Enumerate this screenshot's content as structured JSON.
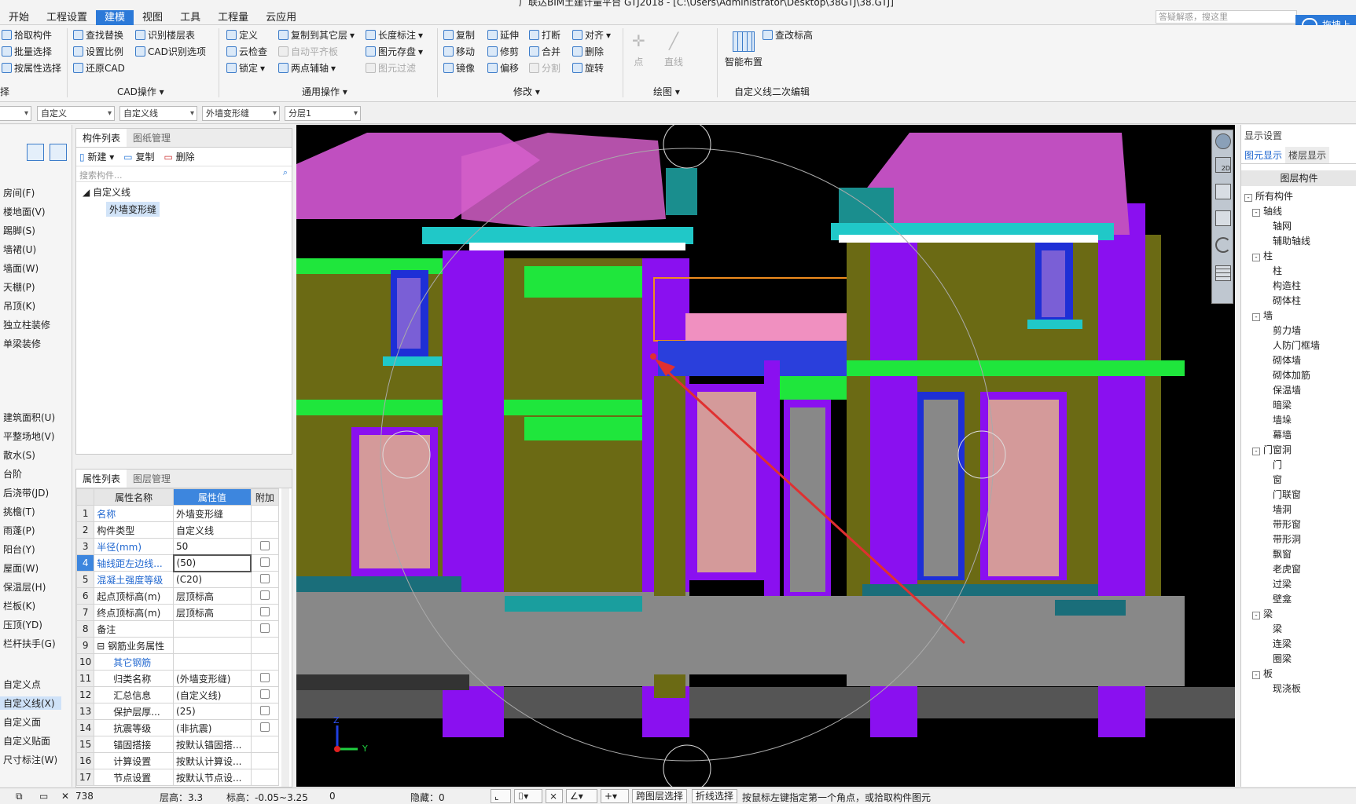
{
  "app": {
    "title": "广联达BIM土建计量平台 GTJ2018 - [C:\\Users\\Administrator\\Desktop\\38GTJ\\38.GTJ]",
    "menu": [
      "开始",
      "工程设置",
      "建模",
      "视图",
      "工具",
      "工程量",
      "云应用"
    ],
    "search_placeholder": "答疑解惑，搜这里",
    "cloud_button": "拖拽上"
  },
  "ribbon": {
    "select": {
      "items": [
        "拾取构件",
        "批量选择",
        "按属性选择"
      ],
      "group": "择"
    },
    "cad": {
      "items": [
        "查找替换",
        "识别楼层表",
        "设置比例",
        "CAD识别选项",
        "还原CAD"
      ],
      "group": "CAD操作"
    },
    "general": {
      "items": [
        "定义",
        "复制到其它层",
        "长度标注",
        "云检查",
        "自动平齐板",
        "图元存盘",
        "锁定",
        "两点辅轴",
        "图元过滤"
      ],
      "group": "通用操作"
    },
    "modify": {
      "items": [
        "复制",
        "延伸",
        "打断",
        "对齐",
        "移动",
        "修剪",
        "合并",
        "删除",
        "镜像",
        "偏移",
        "分割",
        "旋转"
      ],
      "group": "修改"
    },
    "draw": {
      "items": [
        "点",
        "直线"
      ],
      "group": "绘图"
    },
    "custom": {
      "items": [
        "查改标高",
        "智能布置"
      ],
      "group": "自定义线二次编辑"
    }
  },
  "filters": [
    "",
    "自定义",
    "自定义线",
    "外墙变形缝",
    "分层1"
  ],
  "leftnav": {
    "items": [
      "房间(F)",
      "楼地面(V)",
      "踢脚(S)",
      "墙裙(U)",
      "墙面(W)",
      "天棚(P)",
      "吊顶(K)",
      "独立柱装修",
      "单梁装修",
      "建筑面积(U)",
      "平整场地(V)",
      "散水(S)",
      "台阶",
      "后浇带(JD)",
      "挑檐(T)",
      "雨蓬(P)",
      "阳台(Y)",
      "屋面(W)",
      "保温层(H)",
      "栏板(K)",
      "压顶(YD)",
      "栏杆扶手(G)",
      "自定义点",
      "自定义线(X)",
      "自定义面",
      "自定义贴面",
      "尺寸标注(W)"
    ]
  },
  "component_panel": {
    "tabs": [
      "构件列表",
      "图纸管理"
    ],
    "toolbar": {
      "new": "新建",
      "copy": "复制",
      "delete": "删除"
    },
    "search_placeholder": "搜索构件...",
    "tree": {
      "root": "自定义线",
      "child": "外墙变形缝"
    }
  },
  "property_panel": {
    "tabs": [
      "属性列表",
      "图层管理"
    ],
    "headers": [
      "属性名称",
      "属性值",
      "附加"
    ],
    "rows": [
      {
        "n": "1",
        "name": "名称",
        "value": "外墙变形缝",
        "blue": true,
        "cb": false
      },
      {
        "n": "2",
        "name": "构件类型",
        "value": "自定义线",
        "blue": false,
        "cb": false
      },
      {
        "n": "3",
        "name": "半径(mm)",
        "value": "50",
        "blue": true,
        "cb": true
      },
      {
        "n": "4",
        "name": "轴线距左边线...",
        "value": "(50)",
        "blue": true,
        "cb": true
      },
      {
        "n": "5",
        "name": "混凝土强度等级",
        "value": "(C20)",
        "blue": true,
        "cb": true
      },
      {
        "n": "6",
        "name": "起点顶标高(m)",
        "value": "层顶标高",
        "blue": false,
        "cb": true
      },
      {
        "n": "7",
        "name": "终点顶标高(m)",
        "value": "层顶标高",
        "blue": false,
        "cb": true
      },
      {
        "n": "8",
        "name": "备注",
        "value": "",
        "blue": false,
        "cb": true
      },
      {
        "n": "9",
        "name": "钢筋业务属性",
        "value": "",
        "blue": false,
        "cb": false
      },
      {
        "n": "10",
        "name": "其它钢筋",
        "value": "",
        "blue": true,
        "cb": false
      },
      {
        "n": "11",
        "name": "归类名称",
        "value": "(外墙变形缝)",
        "blue": false,
        "cb": true
      },
      {
        "n": "12",
        "name": "汇总信息",
        "value": "(自定义线)",
        "blue": false,
        "cb": true
      },
      {
        "n": "13",
        "name": "保护层厚...",
        "value": "(25)",
        "blue": false,
        "cb": true
      },
      {
        "n": "14",
        "name": "抗震等级",
        "value": "(非抗震)",
        "blue": false,
        "cb": true
      },
      {
        "n": "15",
        "name": "锚固搭接",
        "value": "按默认锚固搭...",
        "blue": false,
        "cb": false
      },
      {
        "n": "16",
        "name": "计算设置",
        "value": "按默认计算设...",
        "blue": false,
        "cb": false
      },
      {
        "n": "17",
        "name": "节点设置",
        "value": "按默认节点设...",
        "blue": false,
        "cb": false
      }
    ]
  },
  "right_panel": {
    "title": "显示设置",
    "tabs": [
      "图元显示",
      "楼层显示"
    ],
    "header": "图层构件",
    "tree": [
      {
        "t": "所有构件",
        "l": 0,
        "pm": "-"
      },
      {
        "t": "轴线",
        "l": 1,
        "pm": "-"
      },
      {
        "t": "轴网",
        "l": 2
      },
      {
        "t": "辅助轴线",
        "l": 2
      },
      {
        "t": "柱",
        "l": 1,
        "pm": "-"
      },
      {
        "t": "柱",
        "l": 2
      },
      {
        "t": "构造柱",
        "l": 2
      },
      {
        "t": "砌体柱",
        "l": 2
      },
      {
        "t": "墙",
        "l": 1,
        "pm": "-"
      },
      {
        "t": "剪力墙",
        "l": 2
      },
      {
        "t": "人防门框墙",
        "l": 2
      },
      {
        "t": "砌体墙",
        "l": 2
      },
      {
        "t": "砌体加筋",
        "l": 2
      },
      {
        "t": "保温墙",
        "l": 2
      },
      {
        "t": "暗梁",
        "l": 2
      },
      {
        "t": "墙垛",
        "l": 2
      },
      {
        "t": "幕墙",
        "l": 2
      },
      {
        "t": "门窗洞",
        "l": 1,
        "pm": "-"
      },
      {
        "t": "门",
        "l": 2
      },
      {
        "t": "窗",
        "l": 2
      },
      {
        "t": "门联窗",
        "l": 2
      },
      {
        "t": "墙洞",
        "l": 2
      },
      {
        "t": "带形窗",
        "l": 2
      },
      {
        "t": "带形洞",
        "l": 2
      },
      {
        "t": "飘窗",
        "l": 2
      },
      {
        "t": "老虎窗",
        "l": 2
      },
      {
        "t": "过梁",
        "l": 2
      },
      {
        "t": "壁龛",
        "l": 2
      },
      {
        "t": "梁",
        "l": 1,
        "pm": "-"
      },
      {
        "t": "梁",
        "l": 2
      },
      {
        "t": "连梁",
        "l": 2
      },
      {
        "t": "圈梁",
        "l": 2
      },
      {
        "t": "板",
        "l": 1,
        "pm": "-"
      },
      {
        "t": "现浇板",
        "l": 2
      }
    ]
  },
  "viewport": {
    "axis_z": "Z",
    "axis_y": "Y",
    "badge": "2D"
  },
  "status": {
    "coord": "738",
    "floor_height": "层高：3.3",
    "elevation": "标高：-0.05~3.25",
    "count": "0",
    "hidden": "隐藏：0",
    "btn_cross": "跨图层选择",
    "btn_polyline": "折线选择",
    "hint": "按鼠标左键指定第一个角点，或拾取构件图元"
  }
}
